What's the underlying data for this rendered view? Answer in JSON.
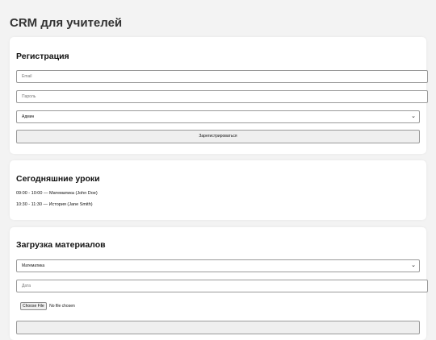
{
  "app": {
    "title": "CRM для учителей"
  },
  "registration": {
    "title": "Регистрация",
    "email_placeholder": "Email",
    "password_placeholder": "Пароль",
    "role_selected": "Админ",
    "submit_label": "Зарегистрироваться"
  },
  "lessons": {
    "title": "Сегодняшние уроки",
    "items": [
      "09:00 - 10:00 — Математика (John Doe)",
      "10:30 - 11:30 — История (Jane Smith)"
    ]
  },
  "upload": {
    "title": "Загрузка материалов",
    "subject_selected": "Математика",
    "date_placeholder": "Дата",
    "file_button_label": "Choose File",
    "file_status": "No file chosen"
  }
}
